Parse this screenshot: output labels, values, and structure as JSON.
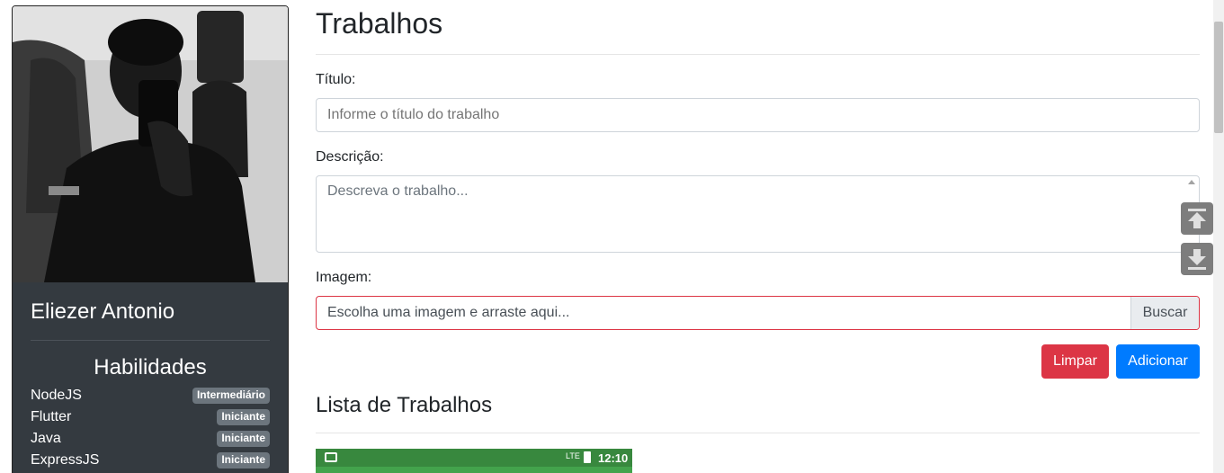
{
  "profile": {
    "name": "Eliezer Antonio",
    "skills_title": "Habilidades",
    "skills": [
      {
        "name": "NodeJS",
        "level": "Intermediário"
      },
      {
        "name": "Flutter",
        "level": "Iniciante"
      },
      {
        "name": "Java",
        "level": "Iniciante"
      },
      {
        "name": "ExpressJS",
        "level": "Iniciante"
      }
    ]
  },
  "form": {
    "page_title": "Trabalhos",
    "title_label": "Título:",
    "title_placeholder": "Informe o título do trabalho",
    "description_label": "Descrição:",
    "description_placeholder": "Descreva o trabalho...",
    "image_label": "Imagem:",
    "image_placeholder": "Escolha uma imagem e arraste aqui...",
    "browse_label": "Buscar",
    "clear_label": "Limpar",
    "add_label": "Adicionar"
  },
  "list": {
    "title": "Lista de Trabalhos",
    "first_item_status": {
      "network": "LTE",
      "time": "12:10"
    }
  },
  "icons": {
    "scroll_top": "arrow-up-to-line-icon",
    "scroll_bottom": "arrow-down-to-line-icon"
  },
  "colors": {
    "sidebar_bg": "#343a40",
    "danger": "#dc3545",
    "primary": "#007bff",
    "badge": "#6c757d"
  }
}
